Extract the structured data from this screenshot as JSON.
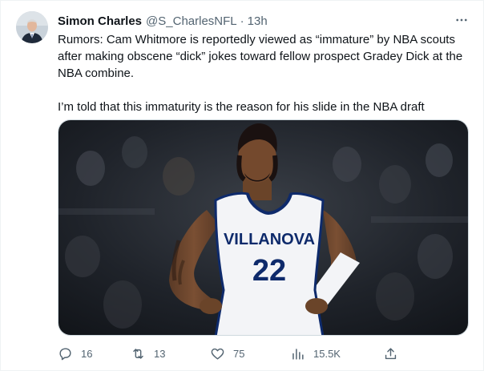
{
  "author": {
    "name": "Simon Charles",
    "handle": "@S_CharlesNFL",
    "separator": "·",
    "time": "13h"
  },
  "tweet": {
    "paragraph1": "Rumors: Cam Whitmore is reportedly viewed as “immature” by NBA scouts after making obscene “dick” jokes toward fellow prospect Gradey Dick at the NBA combine.",
    "paragraph2": "I’m told that this immaturity is the reason for his slide in the NBA draft"
  },
  "media": {
    "jersey_school": "VILLANOVA",
    "jersey_number": "22"
  },
  "actions": {
    "replies": "16",
    "retweets": "13",
    "likes": "75",
    "views": "15.5K"
  },
  "icons": {
    "more": "more-icon",
    "reply": "reply-icon",
    "retweet": "retweet-icon",
    "like": "like-icon",
    "views": "views-icon",
    "share": "share-icon"
  },
  "colors": {
    "text": "#0f1419",
    "secondary": "#536471",
    "jersey": "#f3f4f7",
    "jersey_trim": "#0e2a6b"
  }
}
